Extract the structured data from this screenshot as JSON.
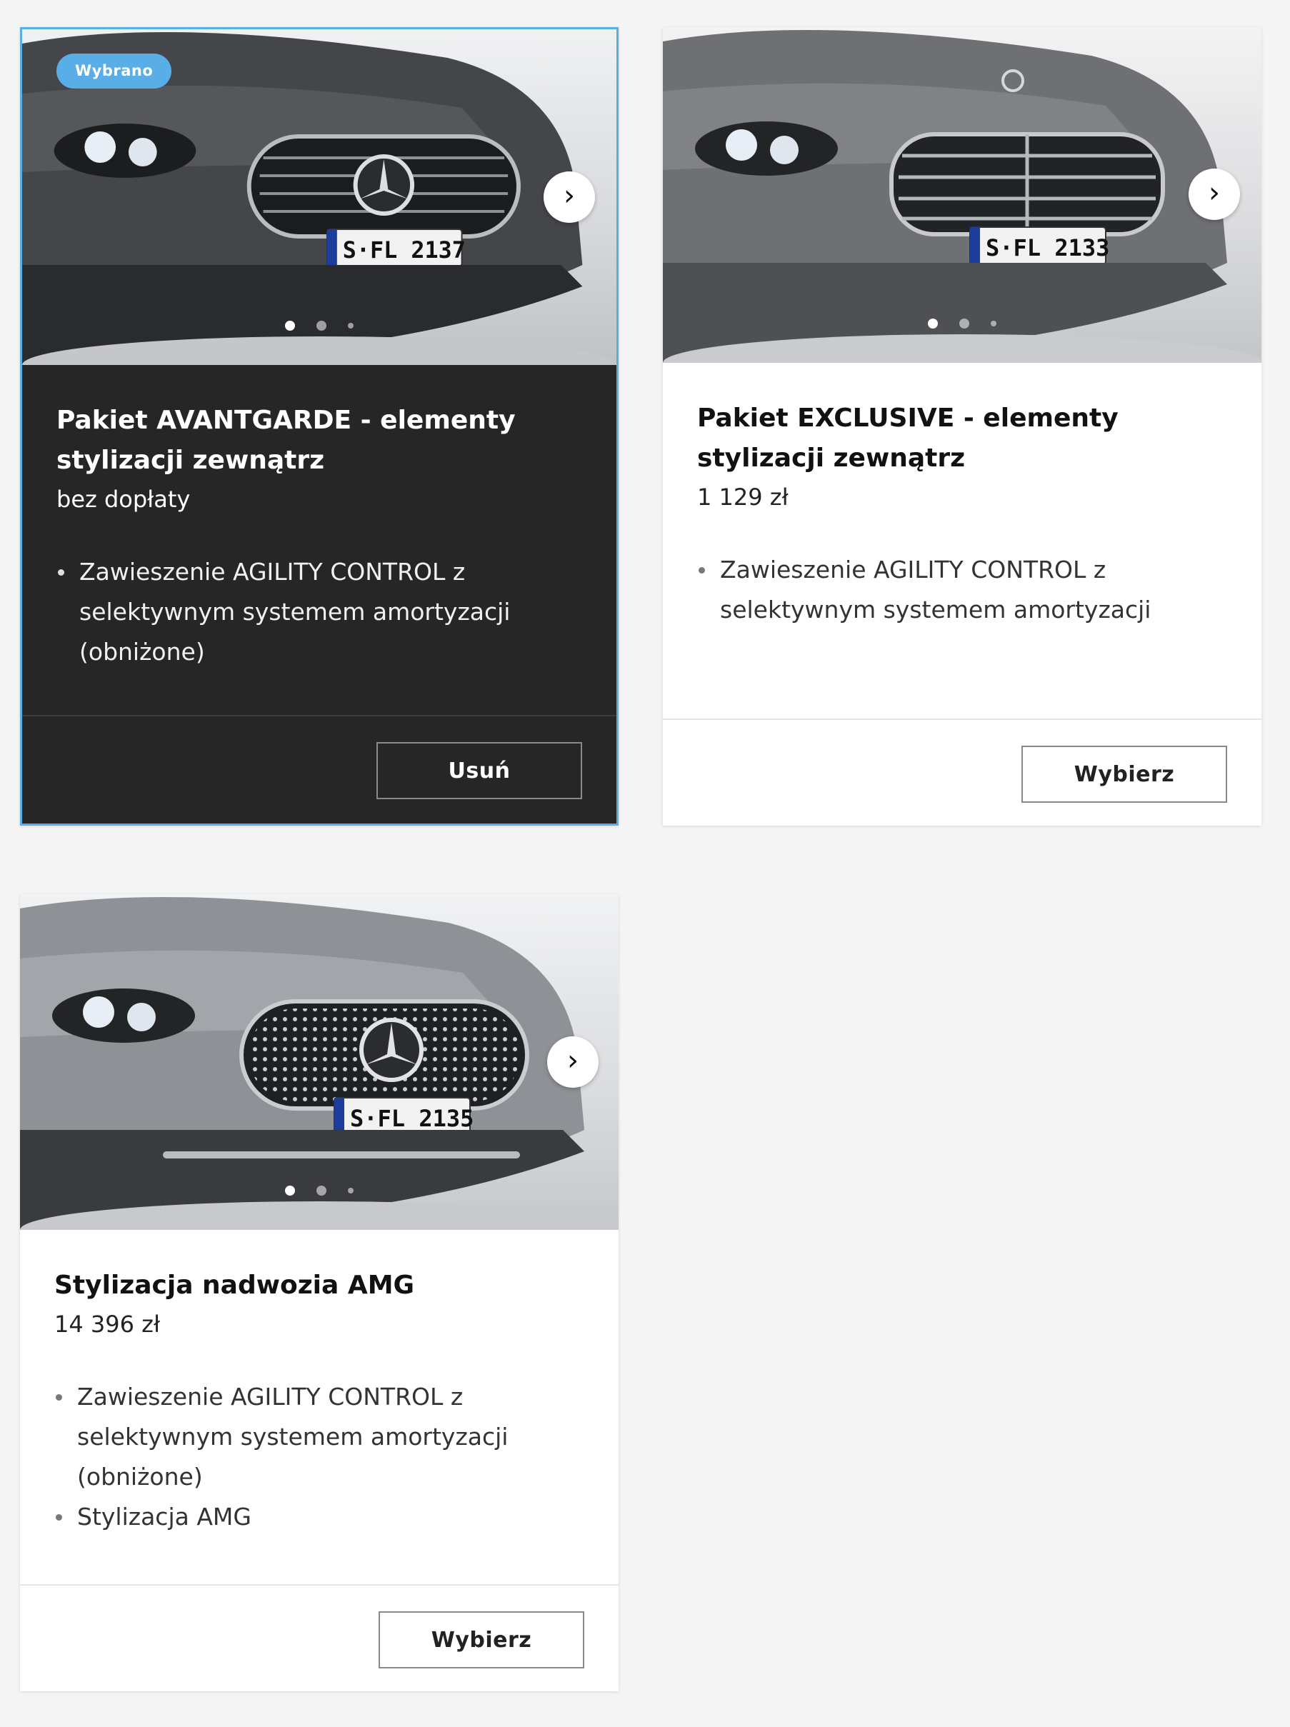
{
  "cards": [
    {
      "badge": "Wybrano",
      "title": "Pakiet AVANTGARDE - elementy stylizacji zewnątrz",
      "price": "bez dopłaty",
      "features": [
        "Zawieszenie AGILITY CONTROL z selektywnym systemem amortyzacji (obniżone)"
      ],
      "plate": "S·FL 2137",
      "button_label": "Usuń",
      "next_glyph": "›",
      "car_color": "#4a4c50",
      "selected": true
    },
    {
      "title": "Pakiet EXCLUSIVE - elementy stylizacji zewnątrz",
      "price": "1 129 zł",
      "features": [
        "Zawieszenie AGILITY CONTROL z selektywnym systemem amortyzacji"
      ],
      "plate": "S·FL 2133",
      "button_label": "Wybierz",
      "next_glyph": "›",
      "car_color": "#77797c",
      "selected": false
    },
    {
      "title": "Stylizacja nadwozia AMG",
      "price": "14 396 zł",
      "features": [
        "Zawieszenie AGILITY CONTROL z selektywnym systemem amortyzacji (obniżone)",
        "Stylizacja AMG"
      ],
      "plate": "S·FL 2135",
      "button_label": "Wybierz",
      "next_glyph": "›",
      "car_color": "#9b9ea3",
      "selected": false
    }
  ],
  "colors": {
    "selected_border": "#5aaee6",
    "badge_bg": "#59aee8",
    "selected_bg": "#262626",
    "page_bg": "#f4f4f4"
  },
  "icons": {
    "next": "chevron-right-icon",
    "car": "car-front-image"
  }
}
